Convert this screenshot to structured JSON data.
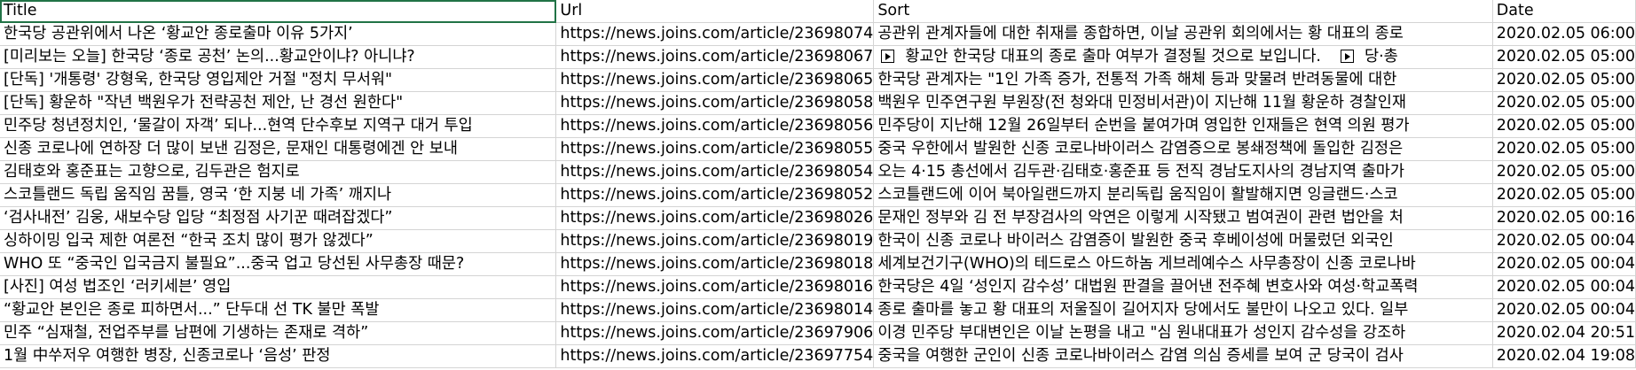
{
  "headers": [
    "Title",
    "Url",
    "Sort",
    "Date"
  ],
  "rows": [
    {
      "title": "한국당 공관위에서 나온 ‘황교안 종로출마 이유 5가지’",
      "url": "https://news.joins.com/article/23698074",
      "sort": "공관위 관계자들에 대한 취재를 종합하면, 이날 공관위 회의에서는 황 대표의 종로",
      "date": "2020.02.05 06:00"
    },
    {
      "title": "[미리보는 오늘] 한국당 ‘종로 공천’ 논의...황교안이냐? 아니냐?",
      "url": "https://news.joins.com/article/23698067",
      "sort_parts": [
        "황교안 한국당 대표의 종로 출마 여부가 결정될 것으로 보입니다.",
        "당·총"
      ],
      "date": "2020.02.05 05:00"
    },
    {
      "title": "[단독] '개통령' 강형욱, 한국당 영입제안 거절 \"정치 무서워\"",
      "url": "https://news.joins.com/article/23698065",
      "sort": "한국당 관계자는 \"1인 가족 증가, 전통적 가족 해체 등과 맞물려 반려동물에 대한",
      "date": "2020.02.05 05:00"
    },
    {
      "title": "[단독] 황운하 \"작년 백원우가 전략공천 제안, 난 경선 원한다\"",
      "url": "https://news.joins.com/article/23698058",
      "sort": "백원우 민주연구원 부원장(전 청와대 민정비서관)이 지난해 11월 황운하 경찰인재",
      "date": "2020.02.05 05:00"
    },
    {
      "title": "민주당 청년정치인, ‘물갈이 자객’ 되나...현역 단수후보 지역구 대거 투입",
      "url": "https://news.joins.com/article/23698056",
      "sort": "민주당이 지난해 12월 26일부터 순번을 붙여가며 영입한 인재들은 현역 의원 평가",
      "date": "2020.02.05 05:00"
    },
    {
      "title": "신종 코로나에 연하장 더 많이 보낸 김정은, 문재인 대통령에겐 안 보내",
      "url": "https://news.joins.com/article/23698055",
      "sort": "중국 우한에서 발원한 신종 코로나바이러스 감염증으로 봉쇄정책에 돌입한 김정은",
      "date": "2020.02.05 05:00"
    },
    {
      "title": "김태호와 홍준표는 고향으로, 김두관은 험지로",
      "url": "https://news.joins.com/article/23698054",
      "sort": "오는 4·15 총선에서 김두관·김태호·홍준표 등 전직 경남도지사의 경남지역 출마가",
      "date": "2020.02.05 05:00"
    },
    {
      "title": "스코틀랜드 독립 움직임 꿈틀, 영국 ‘한 지붕 네 가족’ 깨지나",
      "url": "https://news.joins.com/article/23698052",
      "sort": "스코틀랜드에 이어 북아일랜드까지 분리독립 움직임이 활발해지면 잉글랜드·스코",
      "date": "2020.02.05 05:00"
    },
    {
      "title": "‘검사내전’ 김웅, 새보수당 입당 “최정점 사기꾼 때려잡겠다”",
      "url": "https://news.joins.com/article/23698026",
      "sort": "문재인 정부와 김 전 부장검사의 악연은 이렇게 시작됐고 범여권이 관련 법안을 처",
      "date": "2020.02.05 00:16"
    },
    {
      "title": "싱하이밍 입국 제한 여론전 “한국 조치 많이 평가 않겠다”",
      "url": "https://news.joins.com/article/23698019",
      "sort": "한국이 신종 코로나 바이러스 감염증이 발원한 중국 후베이성에 머물렀던 외국인",
      "date": "2020.02.05 00:04"
    },
    {
      "title": "WHO 또 “중국인 입국금지 불필요”...중국 업고 당선된 사무총장 때문?",
      "url": "https://news.joins.com/article/23698018",
      "sort": "세계보건기구(WHO)의 테드로스 아드하놈 게브레예수스 사무총장이 신종 코로나바",
      "date": "2020.02.05 00:04"
    },
    {
      "title": "[사진] 여성 법조인 ‘러키세븐’ 영입",
      "url": "https://news.joins.com/article/23698016",
      "sort": "한국당은 4일 ‘성인지 감수성’ 대법원 판결을 끌어낸 전주혜 변호사와 여성·학교폭력",
      "date": "2020.02.05 00:04"
    },
    {
      "title": "“황교안 본인은 종로 피하면서...” 단두대 선 TK 불만 폭발",
      "url": "https://news.joins.com/article/23698014",
      "sort": "종로 출마를 놓고 황 대표의 저울질이 길어지자 당에서도 불만이 나오고 있다. 일부",
      "date": "2020.02.05 00:04"
    },
    {
      "title": "민주 “심재철, 전업주부를 남편에 기생하는 존재로 격하”",
      "url": "https://news.joins.com/article/23697906",
      "sort": "이경 민주당 부대변인은 이날 논평을 내고 \"심 원내대표가 성인지 감수성을 강조하",
      "date": "2020.02.04 20:51"
    },
    {
      "title": "1월 中쑤저우 여행한 병장, 신종코로나 ‘음성’ 판정",
      "url": "https://news.joins.com/article/23697754",
      "sort": "중국을 여행한 군인이 신종 코로나바이러스 감염 의심 증세를 보여 군 당국이 검사",
      "date": "2020.02.04 19:08"
    }
  ]
}
